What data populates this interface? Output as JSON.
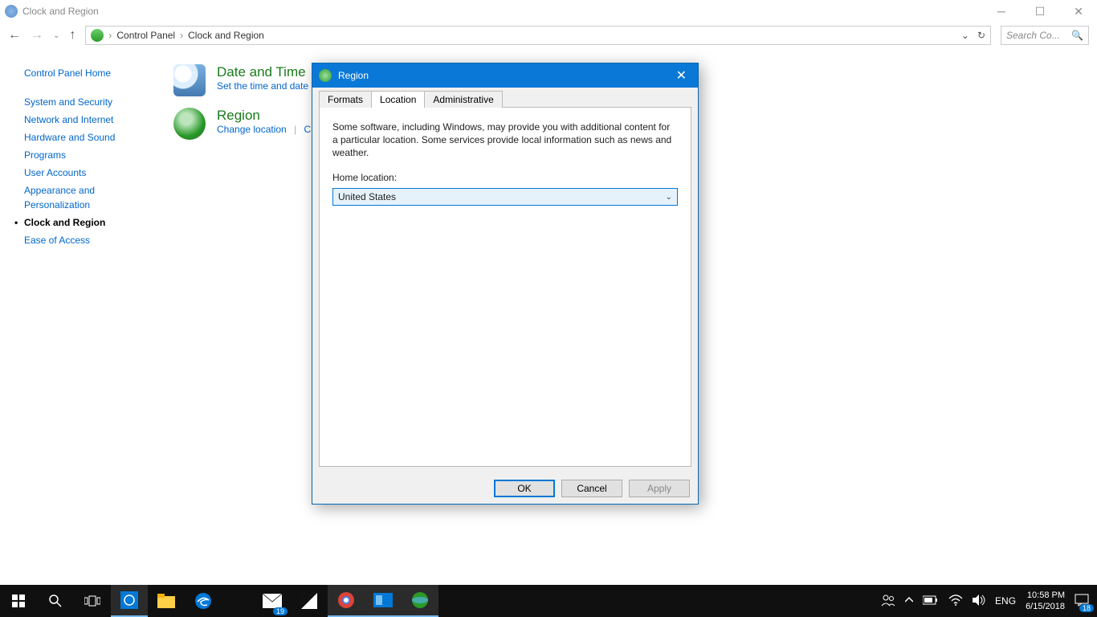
{
  "window": {
    "title": "Clock and Region"
  },
  "breadcrumb": {
    "root": "Control Panel",
    "current": "Clock and Region"
  },
  "search": {
    "placeholder": "Search Co..."
  },
  "sidebar": {
    "home": "Control Panel Home",
    "items": [
      "System and Security",
      "Network and Internet",
      "Hardware and Sound",
      "Programs",
      "User Accounts",
      "Appearance and Personalization",
      "Clock and Region",
      "Ease of Access"
    ]
  },
  "content": {
    "dateandtime": {
      "title": "Date and Time",
      "link1": "Set the time and date"
    },
    "region": {
      "title": "Region",
      "link1": "Change location",
      "link2_partial": "Ch"
    }
  },
  "dialog": {
    "title": "Region",
    "tabs": {
      "formats": "Formats",
      "location": "Location",
      "administrative": "Administrative"
    },
    "description": "Some software, including Windows, may provide you with additional content for a particular location. Some services provide local information such as news and weather.",
    "home_location_label": "Home location:",
    "home_location_value": "United States",
    "buttons": {
      "ok": "OK",
      "cancel": "Cancel",
      "apply": "Apply"
    }
  },
  "taskbar": {
    "mail_badge": "19",
    "lang": "ENG",
    "time": "10:58 PM",
    "date": "6/15/2018",
    "action_badge": "18"
  }
}
